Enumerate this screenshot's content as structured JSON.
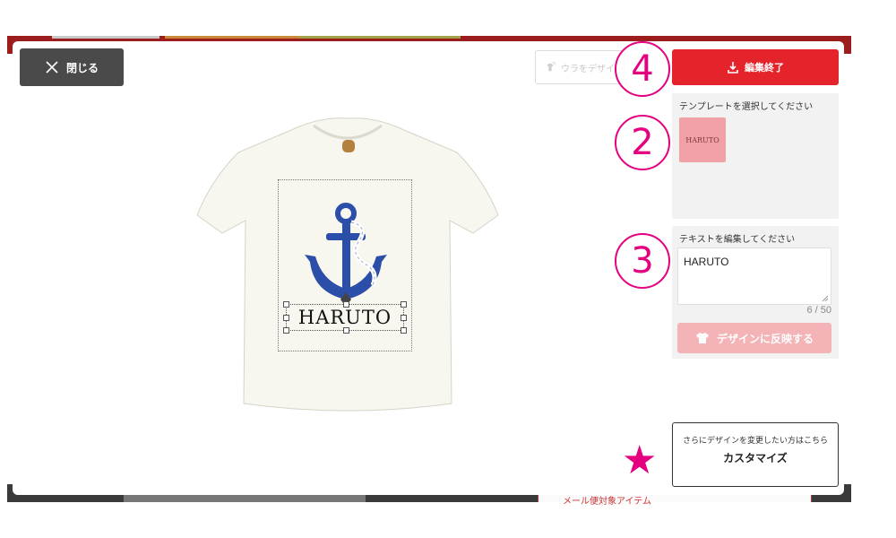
{
  "header": {
    "close_label": "閉じる",
    "back_label": "ウラをデザイン",
    "finish_label": "編集終了"
  },
  "template_panel": {
    "title": "テンプレートを選択してください",
    "thumbnail_text": "HARUTO"
  },
  "text_panel": {
    "title": "テキストを編集してください",
    "text_value": "HARUTO",
    "counter": "6 / 50",
    "reflect_label": "デザインに反映する"
  },
  "customize": {
    "sub_label": "さらにデザインを変更したい方はこちら",
    "main_label": "カスタマイズ"
  },
  "annotations": {
    "step_finish": "4",
    "step_template": "2",
    "step_text": "3",
    "star": "★"
  },
  "design": {
    "name_text": "HARUTO"
  },
  "background": {
    "mail_text": "メール便対象アイテム"
  },
  "colors": {
    "accent": "#e5232b",
    "annotation": "#e4007f",
    "anchor": "#2b4ea8",
    "disabled_button": "#f4b3b6",
    "template_thumb": "#f0a0a6",
    "shirt": "#f7f6ef"
  },
  "icons": [
    "close-icon",
    "shirt-flip-icon",
    "download-icon",
    "tshirt-icon",
    "anchor-icon",
    "resize-grip-icon"
  ]
}
